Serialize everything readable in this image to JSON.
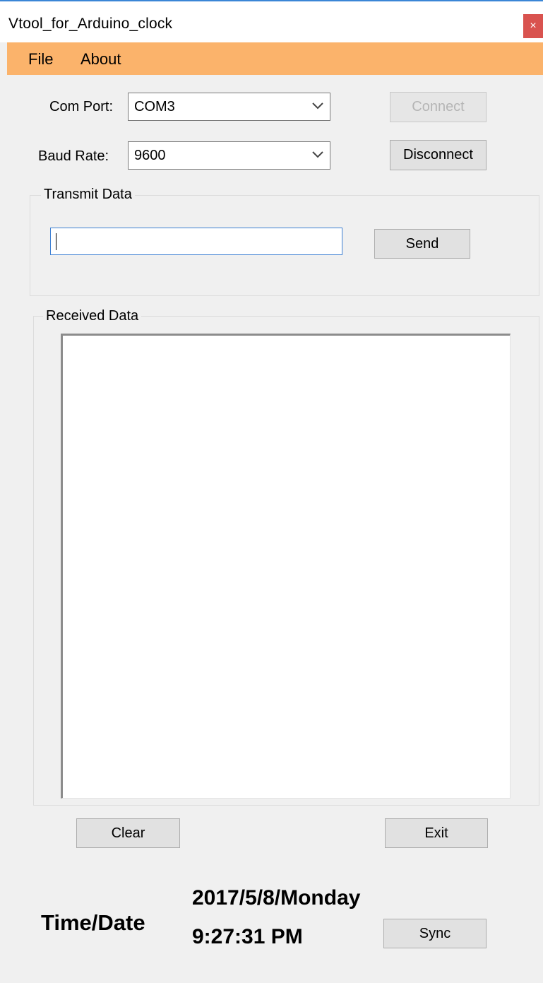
{
  "window": {
    "title": "Vtool_for_Arduino_clock",
    "close_glyph": "×"
  },
  "menu": {
    "items": [
      {
        "label": "File"
      },
      {
        "label": "About"
      }
    ]
  },
  "port": {
    "label": "Com Port:",
    "value": "COM3",
    "connect_label": "Connect"
  },
  "baud": {
    "label": "Baud Rate:",
    "value": "9600",
    "disconnect_label": "Disconnect"
  },
  "transmit": {
    "legend": "Transmit Data",
    "value": "",
    "send_label": "Send"
  },
  "received": {
    "legend": "Received Data",
    "content": ""
  },
  "actions": {
    "clear_label": "Clear",
    "exit_label": "Exit"
  },
  "clock": {
    "label": "Time/Date",
    "date": "2017/5/8/Monday",
    "time": "9:27:31 PM",
    "sync_label": "Sync"
  },
  "colors": {
    "menubar": "#fbb36b",
    "close": "#d9534f",
    "focus": "#3c7fd2"
  }
}
